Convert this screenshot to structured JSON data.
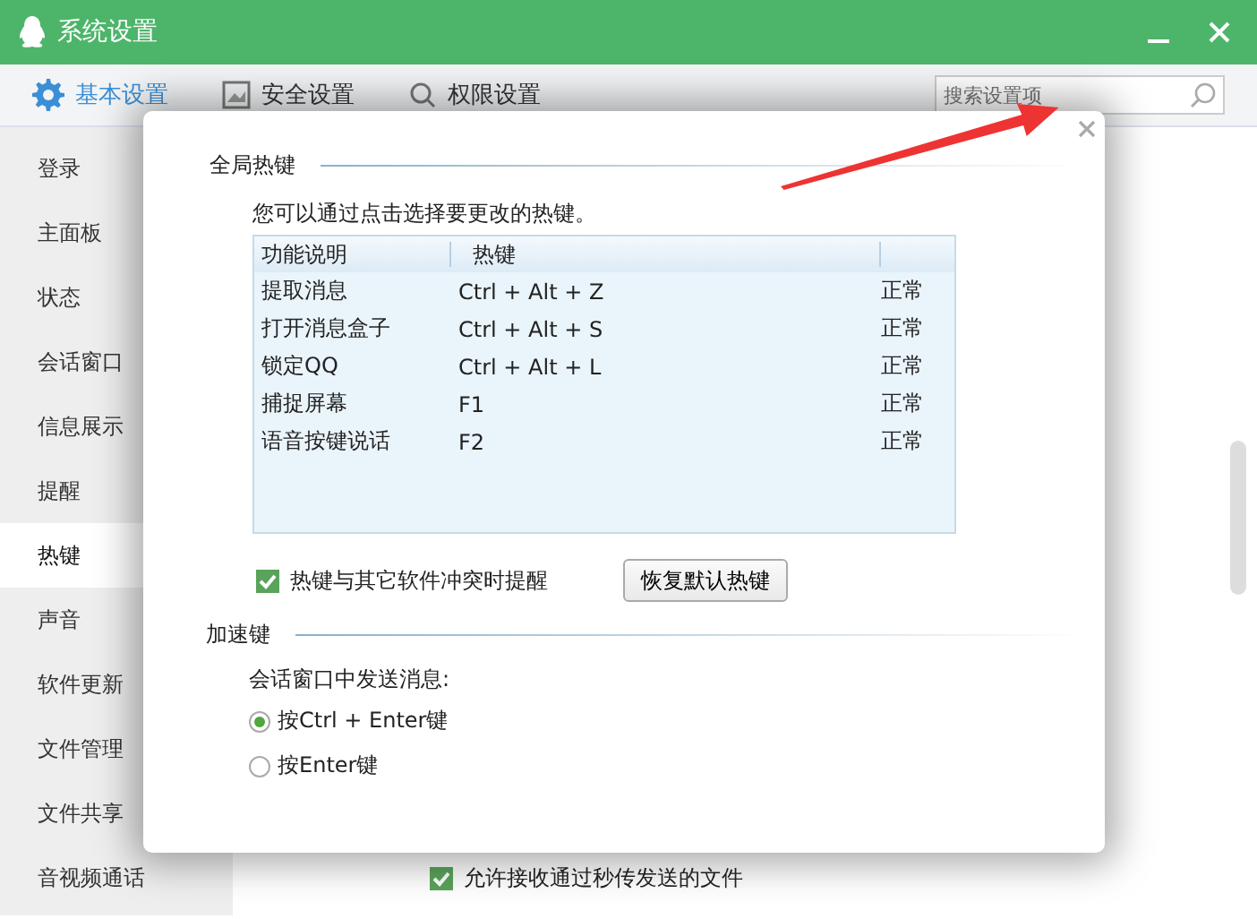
{
  "window": {
    "title": "系统设置"
  },
  "tabs": [
    {
      "label": "基本设置",
      "selected": true
    },
    {
      "label": "安全设置",
      "selected": false
    },
    {
      "label": "权限设置",
      "selected": false
    }
  ],
  "search": {
    "placeholder": "搜索设置项"
  },
  "sidebar": {
    "items": [
      {
        "label": "登录",
        "selected": false
      },
      {
        "label": "主面板",
        "selected": false
      },
      {
        "label": "状态",
        "selected": false
      },
      {
        "label": "会话窗口",
        "selected": false
      },
      {
        "label": "信息展示",
        "selected": false
      },
      {
        "label": "提醒",
        "selected": false
      },
      {
        "label": "热键",
        "selected": true
      },
      {
        "label": "声音",
        "selected": false
      },
      {
        "label": "软件更新",
        "selected": false
      },
      {
        "label": "文件管理",
        "selected": false
      },
      {
        "label": "文件共享",
        "selected": false
      },
      {
        "label": "音视频通话",
        "selected": false
      }
    ]
  },
  "content": {
    "checkbox": {
      "label": "允许接收通过秒传发送的文件",
      "checked": true
    }
  },
  "dialog": {
    "hotkeys": {
      "title": "全局热键",
      "hint": "您可以通过点击选择要更改的热键。",
      "columns": [
        "功能说明",
        "热键"
      ],
      "rows": [
        {
          "function": "提取消息",
          "hotkey": "Ctrl + Alt + Z",
          "column_3": "正常"
        },
        {
          "function": "打开消息盒子",
          "hotkey": "Ctrl + Alt + S",
          "column_3": "正常"
        },
        {
          "function": "锁定QQ",
          "hotkey": "Ctrl + Alt + L",
          "column_3": "正常"
        },
        {
          "function": "捕捉屏幕",
          "hotkey": "F1",
          "column_3": "正常"
        },
        {
          "function": "语音按键说话",
          "hotkey": "F2",
          "column_3": "正常"
        }
      ],
      "conflict_checkbox": {
        "label": "热键与其它软件冲突时提醒",
        "checked": true
      },
      "restore_button": "恢复默认热键"
    },
    "accelerator": {
      "title": "加速键",
      "prompt": "会话窗口中发送消息:",
      "options": [
        {
          "label": "按Ctrl + Enter键",
          "selected": true
        },
        {
          "label": "按Enter键",
          "selected": false
        }
      ]
    }
  }
}
